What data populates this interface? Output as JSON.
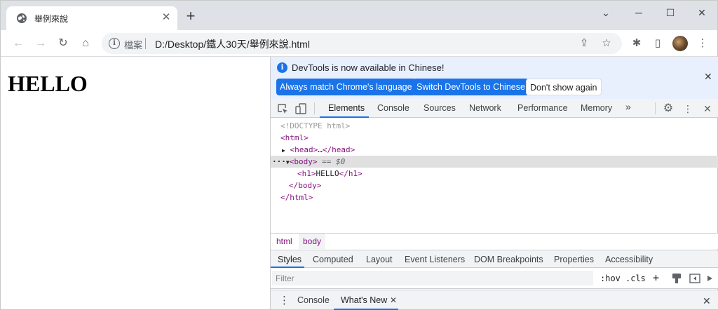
{
  "browser": {
    "tab_title": "舉例來說",
    "tab_close": "✕",
    "new_tab": "+",
    "window_controls": {
      "minimize": "─",
      "maximize": "☐",
      "close": "✕",
      "tab_search": "⌄"
    },
    "nav_icons": {
      "back": "←",
      "forward": "→",
      "reload": "↻",
      "home": "⌂"
    },
    "omnibox": {
      "scheme_label": "檔案",
      "url": "D:/Desktop/鐵人30天/舉例來說.html",
      "info_icon": "i",
      "share_icon": "⇪",
      "bookmark_icon": "☆"
    },
    "toolbar_icons": {
      "extensions": "✱",
      "side_panel": "▯",
      "menu": "⋮"
    }
  },
  "page": {
    "heading": "HELLO"
  },
  "devtools": {
    "banner": {
      "info_icon": "i",
      "message": "DevTools is now available in Chinese!",
      "btn_match": "Always match Chrome's language",
      "btn_switch": "Switch DevTools to Chinese",
      "btn_dismiss": "Don't show again",
      "close": "✕"
    },
    "tabs": [
      "Elements",
      "Console",
      "Sources",
      "Network",
      "Performance",
      "Memory",
      "»"
    ],
    "tab_icons": {
      "inspect": "⬚",
      "device": "▭",
      "settings": "⚙",
      "more": "⋮",
      "close": "✕"
    },
    "dom": {
      "doctype": "<!DOCTYPE html>",
      "html_open": "<html>",
      "head_open": "<head>",
      "head_ellipsis": "…",
      "head_close": "</head>",
      "dots": "···",
      "body_open": "<body>",
      "body_selected": "== $0",
      "h1_open": "<h1>",
      "h1_text": "HELLO",
      "h1_close": "</h1>",
      "body_close": "</body>",
      "html_close": "</html>",
      "arrow_right": "▶",
      "arrow_down": "▼"
    },
    "breadcrumbs": [
      "html",
      "body"
    ],
    "styles_tabs": [
      "Styles",
      "Computed",
      "Layout",
      "Event Listeners",
      "DOM Breakpoints",
      "Properties",
      "Accessibility"
    ],
    "filter": {
      "placeholder": "Filter",
      "hov": ":hov",
      "cls": ".cls",
      "add": "+"
    },
    "drawer": {
      "more_icon": "⋮",
      "tabs": [
        "Console",
        "What's New"
      ],
      "tab_close": "✕",
      "close": "✕"
    }
  }
}
